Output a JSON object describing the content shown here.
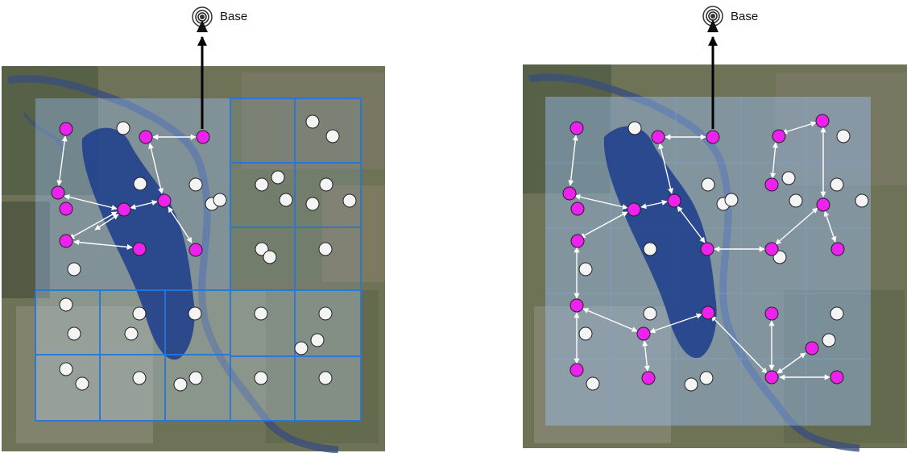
{
  "colors": {
    "active_node": "#ee22ee",
    "idle_node": "#f4f4f4",
    "grid_line": "#2277dd",
    "overlay": "#9ec3ff",
    "water": "#1f3f8c",
    "link": "#ffffff",
    "uplink": "#000000"
  },
  "left_panel": {
    "base_label": "Base",
    "icon": "antenna-icon"
  },
  "right_panel": {
    "base_label": "Base",
    "icon": "antenna-icon"
  }
}
